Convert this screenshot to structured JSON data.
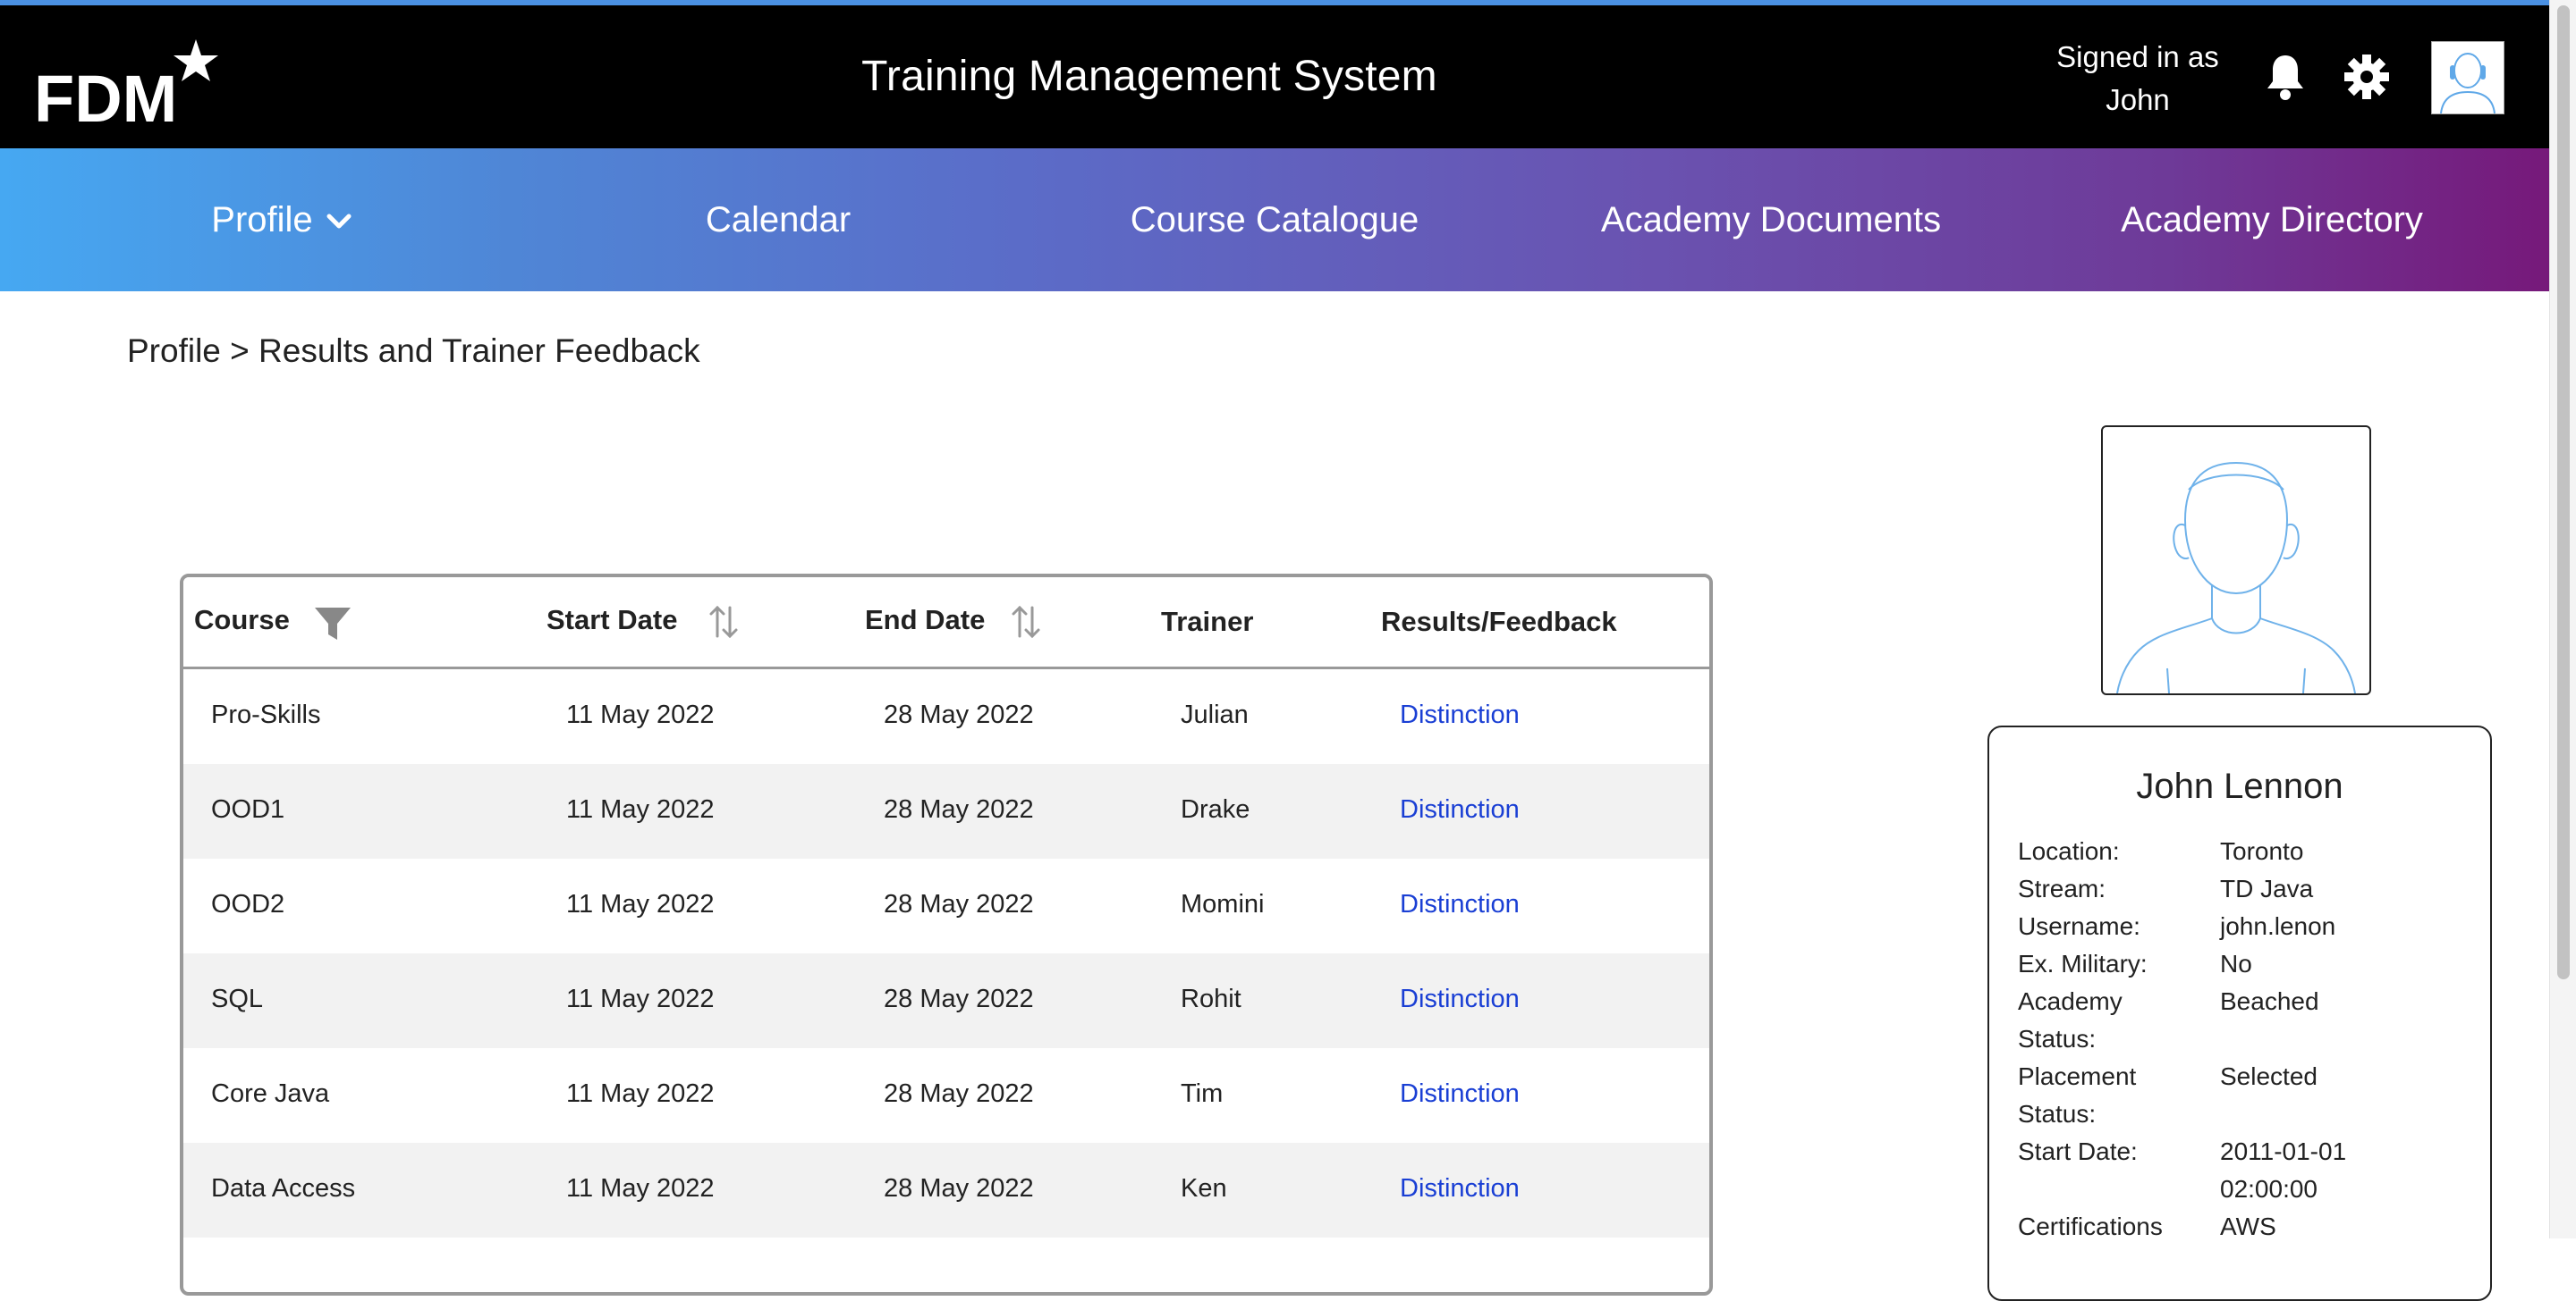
{
  "header": {
    "logo_text": "FDM",
    "title": "Training Management System",
    "signed_in_label": "Signed in as",
    "user_first_name": "John",
    "icons": [
      "bell-icon",
      "gear-icon",
      "avatar-icon"
    ]
  },
  "nav": {
    "items": [
      {
        "label": "Profile",
        "has_dropdown": true
      },
      {
        "label": "Calendar"
      },
      {
        "label": "Course Catalogue"
      },
      {
        "label": "Academy Documents"
      },
      {
        "label": "Academy Directory"
      }
    ]
  },
  "breadcrumb": "Profile > Results and Trainer Feedback",
  "table": {
    "columns": [
      "Course",
      "Start Date",
      "End Date",
      "Trainer",
      "Results/Feedback"
    ],
    "rows": [
      {
        "course": "Pro-Skills",
        "start": "11 May 2022",
        "end": "28 May 2022",
        "trainer": "Julian",
        "result": "Distinction"
      },
      {
        "course": "OOD1",
        "start": "11 May 2022",
        "end": "28 May 2022",
        "trainer": "Drake",
        "result": "Distinction"
      },
      {
        "course": "OOD2",
        "start": "11 May 2022",
        "end": "28 May 2022",
        "trainer": "Momini",
        "result": "Distinction"
      },
      {
        "course": "SQL",
        "start": "11 May 2022",
        "end": "28 May 2022",
        "trainer": "Rohit",
        "result": "Distinction"
      },
      {
        "course": "Core Java",
        "start": "11 May 2022",
        "end": "28 May 2022",
        "trainer": "Tim",
        "result": "Distinction"
      },
      {
        "course": "Data Access",
        "start": "11 May 2022",
        "end": "28 May 2022",
        "trainer": "Ken",
        "result": "Distinction"
      }
    ]
  },
  "profile": {
    "name": "John Lennon",
    "location_label": "Location:",
    "location": "Toronto",
    "stream_label": "Stream:",
    "stream": "TD Java",
    "username_label": "Username:",
    "username": "john.lenon",
    "military_label": "Ex. Military:",
    "military": "No",
    "academy_status_label_1": "Academy",
    "academy_status_label_2": "Status:",
    "academy_status": "Beached",
    "placement_status_label_1": "Placement",
    "placement_status_label_2": "Status:",
    "placement_status": "Selected",
    "start_date_label": "Start Date:",
    "start_date_1": "2011-01-01",
    "start_date_2": "02:00:00",
    "certifications_label": "Certifications",
    "certifications": "AWS"
  },
  "colors": {
    "header_bg": "#000000",
    "top_line": "#4a90e2",
    "nav_gradient_start": "#46a8f2",
    "nav_gradient_end": "#76197a",
    "link": "#1a3fd4",
    "row_alt": "#f2f2f2"
  }
}
